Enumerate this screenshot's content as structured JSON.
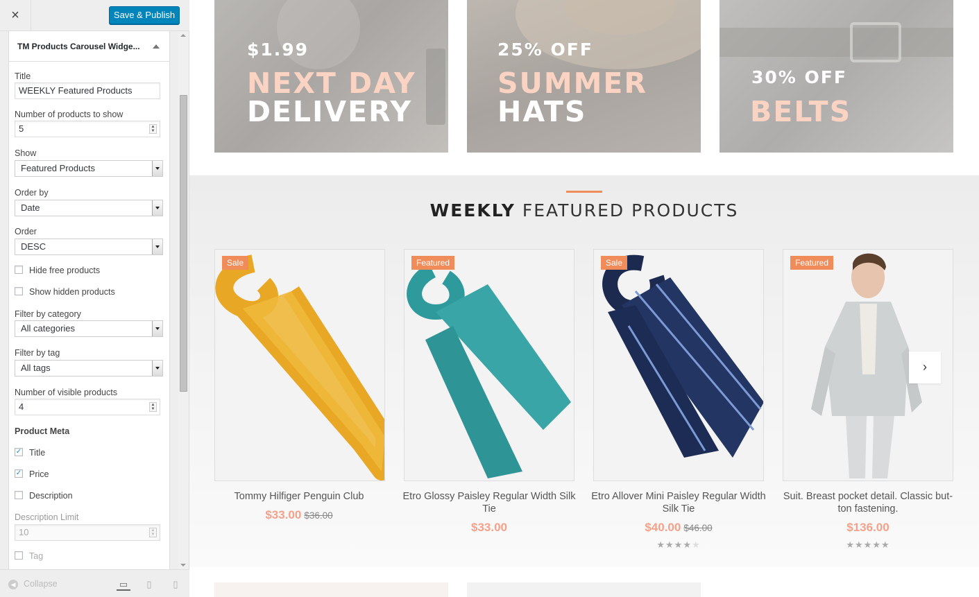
{
  "sidebar": {
    "close_icon": "×",
    "save_label": "Save & Publish",
    "widget_title": "TM Products Carousel Widge...",
    "fields": {
      "title_label": "Title",
      "title_value": "WEEKLY Featured Products",
      "num_products_label": "Number of products to show",
      "num_products_value": "5",
      "show_label": "Show",
      "show_value": "Featured Products",
      "orderby_label": "Order by",
      "orderby_value": "Date",
      "order_label": "Order",
      "order_value": "DESC",
      "hide_free_label": "Hide free products",
      "show_hidden_label": "Show hidden products",
      "filter_cat_label": "Filter by category",
      "filter_cat_value": "All categories",
      "filter_tag_label": "Filter by tag",
      "filter_tag_value": "All tags",
      "visible_label": "Number of visible products",
      "visible_value": "4",
      "product_meta_label": "Product Meta",
      "meta_title_label": "Title",
      "meta_price_label": "Price",
      "meta_desc_label": "Description",
      "desc_limit_label": "Description Limit",
      "desc_limit_value": "10",
      "meta_tag_label": "Tag"
    },
    "checkboxes": {
      "hide_free": false,
      "show_hidden": false,
      "meta_title": true,
      "meta_price": true,
      "meta_description": false,
      "meta_tag": false
    },
    "collapse_label": "Collapse",
    "accent_color": "#0085ba"
  },
  "banners": [
    {
      "tag": "$1.99",
      "line1": "NEXT DAY",
      "line2": "DELIVERY"
    },
    {
      "tag": "25% OFF",
      "line1": "SUMMER",
      "line2": "HATS"
    },
    {
      "tag": "30% OFF",
      "line1": "BELTS"
    }
  ],
  "section": {
    "title_bold": "WEEKLY",
    "title_rest": "FEATURED PRODUCTS",
    "accent_color": "#f08c5a"
  },
  "products": [
    {
      "badge": "Sale",
      "name": "Tommy Hilfiger Penguin Club",
      "price": "$33.00",
      "old_price": "$36.00",
      "rating": null
    },
    {
      "badge": "Featured",
      "name": "Etro Glossy Paisley Regular Width Silk Tie",
      "price": "$33.00",
      "old_price": "",
      "rating": null
    },
    {
      "badge": "Sale",
      "name": "Etro Allover Mini Paisley Regular Width Silk Tie",
      "price": "$40.00",
      "old_price": "$46.00",
      "rating": 4
    },
    {
      "badge": "Featured",
      "name": "Suit. Breast pocket detail. Classic but-ton fastening.",
      "price": "$136.00",
      "old_price": "",
      "rating": 5
    }
  ],
  "carousel": {
    "next_icon": "›"
  }
}
